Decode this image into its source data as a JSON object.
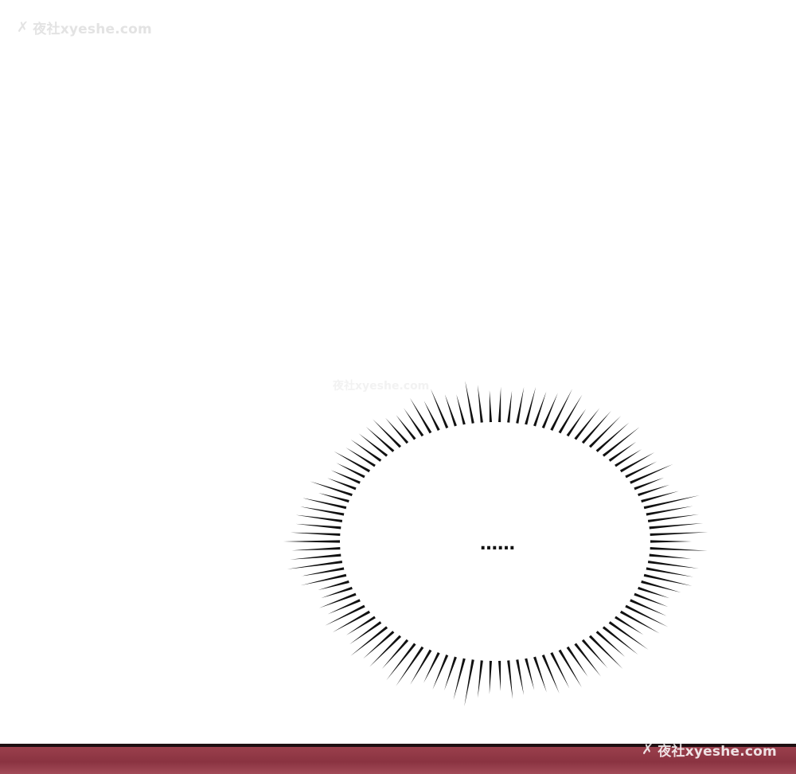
{
  "watermark_top": {
    "icon": "x-logo-icon",
    "text": "夜社xyeshe.com"
  },
  "watermark_bottom": {
    "icon": "x-logo-icon",
    "text": "夜社xyeshe.com"
  },
  "watermark_faint": {
    "text": "夜社xyeshe.com"
  },
  "speech_burst": {
    "text": "……"
  },
  "colors": {
    "background": "#ffffff",
    "burst_stroke": "#111111",
    "next_panel": "#8a3341"
  }
}
